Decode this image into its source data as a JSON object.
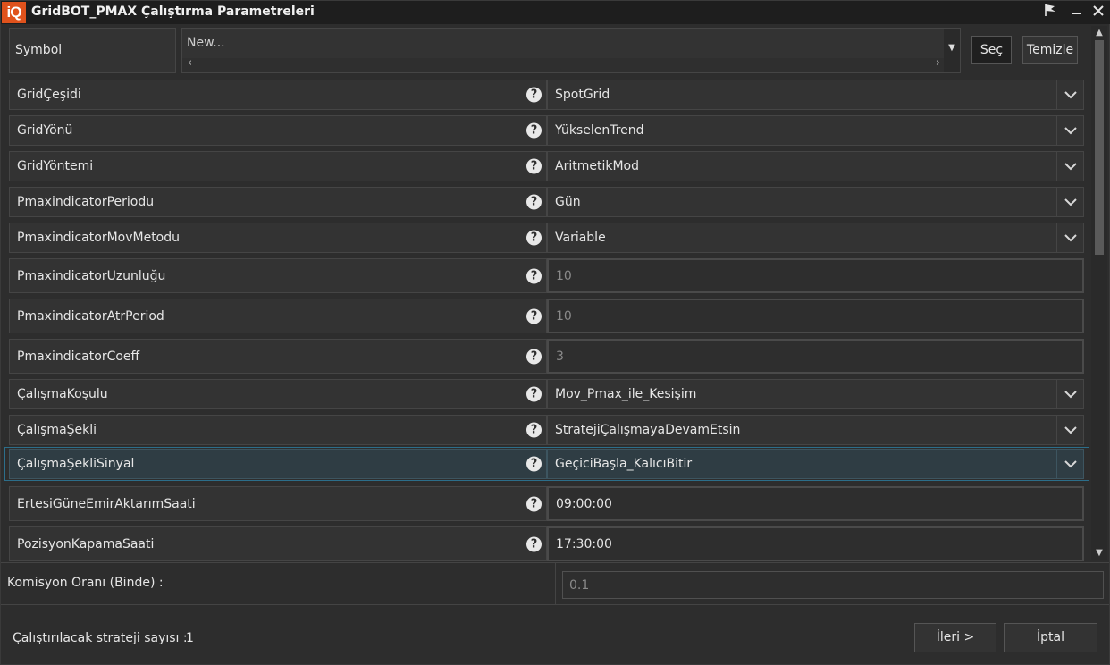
{
  "window": {
    "title": "GridBOT_PMAX Çalıştırma Parametreleri",
    "logo_text": "iQ",
    "pin_icon": "pin-flag-icon",
    "minimize_icon": "minimize-icon",
    "close_icon": "close-icon"
  },
  "symbol": {
    "label": "Symbol",
    "value": "New...",
    "select_button": "Seç",
    "clear_button": "Temizle",
    "scroll_left": "‹",
    "scroll_right": "›"
  },
  "help_glyph": "?",
  "params": [
    {
      "label": "GridÇeşidi",
      "value": "SpotGrid",
      "type": "combo"
    },
    {
      "label": "GridYönü",
      "value": "YükselenTrend",
      "type": "combo"
    },
    {
      "label": "GridYöntemi",
      "value": "AritmetikMod",
      "type": "combo"
    },
    {
      "label": "PmaxindicatorPeriodu",
      "value": "Gün",
      "type": "combo"
    },
    {
      "label": "PmaxindicatorMovMetodu",
      "value": "Variable",
      "type": "combo"
    },
    {
      "label": "PmaxindicatorUzunluğu",
      "value": "10",
      "type": "input"
    },
    {
      "label": "PmaxindicatorAtrPeriod",
      "value": "10",
      "type": "input"
    },
    {
      "label": "PmaxindicatorCoeff",
      "value": "3",
      "type": "input"
    },
    {
      "label": "ÇalışmaKoşulu",
      "value": "Mov_Pmax_ile_Kesişim",
      "type": "combo"
    },
    {
      "label": "ÇalışmaŞekli",
      "value": "StratejiÇalışmayaDevamEtsin",
      "type": "combo"
    },
    {
      "label": "ÇalışmaŞekliSinyal",
      "value": "GeçiciBaşla_KalıcıBitir",
      "type": "combo",
      "active": true
    },
    {
      "label": "ErtesiGüneEmirAktarımSaati",
      "value": "09:00:00",
      "type": "input"
    },
    {
      "label": "PozisyonKapamaSaati",
      "value": "17:30:00",
      "type": "input"
    }
  ],
  "commission": {
    "label": "Komisyon Oranı (Binde) :",
    "value": "0.1"
  },
  "footer": {
    "count_label": "Çalıştırılacak strateji sayısı :",
    "count_value": "1",
    "next_button": "İleri >",
    "cancel_button": "İptal"
  },
  "colors": {
    "accent": "#e0521c",
    "active_border": "#2c6e8a"
  }
}
